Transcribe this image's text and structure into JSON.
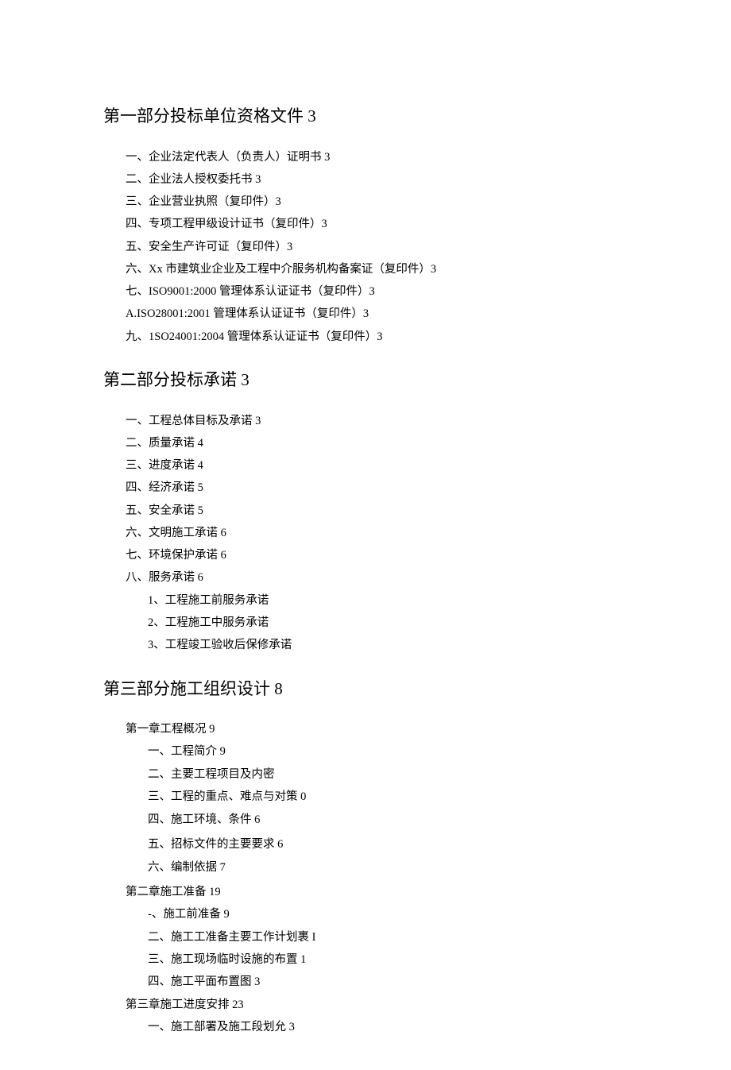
{
  "sections": [
    {
      "heading": "第一部分投标单位资格文件 3",
      "items": [
        {
          "text": "一、企业法定代表人（负责人）证明书 3",
          "level": 1
        },
        {
          "text": "二、企业法人授权委托书 3",
          "level": 1
        },
        {
          "text": "三、企业营业执照（复印件）3",
          "level": 1
        },
        {
          "text": "四、专项工程甲级设计证书（复印件）3",
          "level": 1
        },
        {
          "text": "五、安全生产许可证（复印件）3",
          "level": 1
        },
        {
          "text": "六、Xx 市建筑业企业及工程中介服务机构备案证（复印件）3",
          "level": 1
        },
        {
          "text": "七、ISO9001:2000 管理体系认证证书（复印件）3",
          "level": 1
        },
        {
          "text": "A.ISO28001:2001 管理体系认证证书（复印件）3",
          "level": 1
        },
        {
          "text": "九、1SO24001:2004 管理体系认证证书（复印件）3",
          "level": 1
        }
      ]
    },
    {
      "heading": "第二部分投标承诺 3",
      "items": [
        {
          "text": "一、工程总体目标及承诺 3",
          "level": 1
        },
        {
          "text": "二、质量承诺 4",
          "level": 1
        },
        {
          "text": "三、进度承诺 4",
          "level": 1
        },
        {
          "text": "四、经济承诺 5",
          "level": 1
        },
        {
          "text": "五、安全承诺 5",
          "level": 1
        },
        {
          "text": "六、文明施工承诺 6",
          "level": 1
        },
        {
          "text": "七、环境保护承诺 6",
          "level": 1
        },
        {
          "text": "八、服务承诺 6",
          "level": 1
        },
        {
          "text": "1、工程施工前服务承诺",
          "level": 2
        },
        {
          "text": "2、工程施工中服务承诺",
          "level": 2
        },
        {
          "text": "3、工程竣工验收后保修承诺",
          "level": 2
        }
      ]
    },
    {
      "heading": "第三部分施工组织设计 8",
      "items": [
        {
          "text": "第一章工程概况 9",
          "level": 1
        },
        {
          "text": "一、工程简介 9",
          "level": 2
        },
        {
          "text": "二、主要工程项目及内密",
          "level": 2
        },
        {
          "text": "三、工程的重点、难点与对策 0",
          "level": 2
        },
        {
          "text": "四、施工环境、条件 6",
          "level": 2,
          "spaced": true
        },
        {
          "text": "五、招标文件的主要要求 6",
          "level": 2
        },
        {
          "text": "六、编制依据 7",
          "level": 2,
          "spaced": true
        },
        {
          "text": "第二章施工准备 19",
          "level": 1
        },
        {
          "text": "-、施工前准备 9",
          "level": 2
        },
        {
          "text": "二、施工工准备主要工作计划裹 I",
          "level": 2
        },
        {
          "text": "三、施工现场临时设施的布置 1",
          "level": 2
        },
        {
          "text": "四、施工平面布置图 3",
          "level": 2
        },
        {
          "text": "第三章施工进度安排 23",
          "level": 1
        },
        {
          "text": "一、施工部署及施工段划允 3",
          "level": 2
        }
      ]
    }
  ]
}
